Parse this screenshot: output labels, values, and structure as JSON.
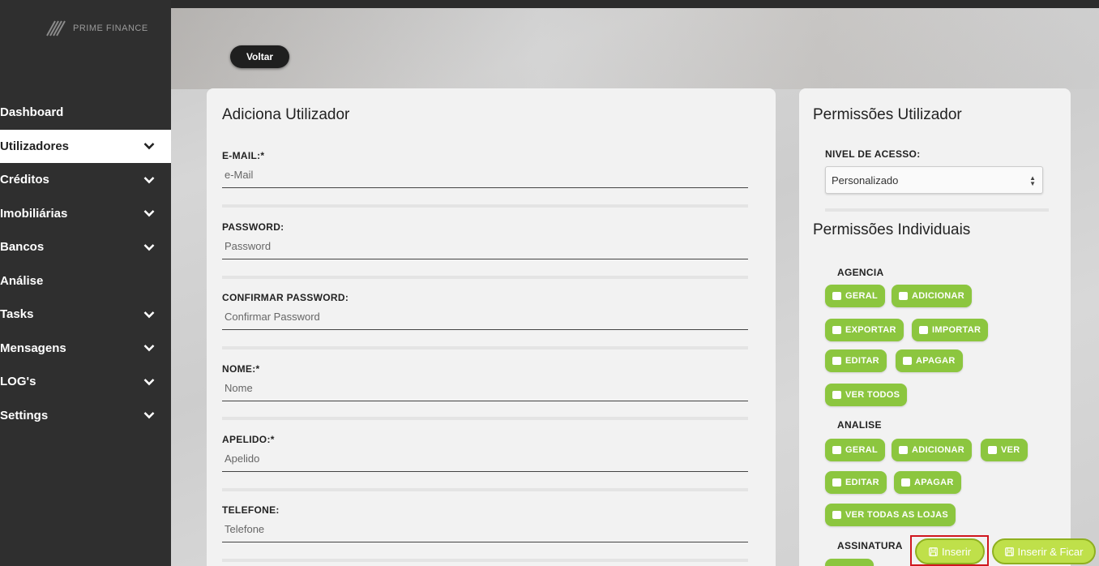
{
  "brand": {
    "name": "PRIME FINANCE"
  },
  "sidebar": {
    "items": [
      {
        "label": "Dashboard",
        "chevron": false,
        "active": false
      },
      {
        "label": "Utilizadores",
        "chevron": true,
        "active": true
      },
      {
        "label": "Créditos",
        "chevron": true,
        "active": false
      },
      {
        "label": "Imobiliárias",
        "chevron": true,
        "active": false
      },
      {
        "label": "Bancos",
        "chevron": true,
        "active": false
      },
      {
        "label": "Análise",
        "chevron": false,
        "active": false
      },
      {
        "label": "Tasks",
        "chevron": true,
        "active": false
      },
      {
        "label": "Mensagens",
        "chevron": true,
        "active": false
      },
      {
        "label": "LOG's",
        "chevron": true,
        "active": false
      },
      {
        "label": "Settings",
        "chevron": true,
        "active": false
      }
    ]
  },
  "back_button": {
    "label": "Voltar"
  },
  "user_form": {
    "title": "Adiciona Utilizador",
    "fields": [
      {
        "label": "E-MAIL:*",
        "placeholder": "e-Mail"
      },
      {
        "label": "PASSWORD:",
        "placeholder": "Password"
      },
      {
        "label": "CONFIRMAR PASSWORD:",
        "placeholder": "Confirmar Password"
      },
      {
        "label": "NOME:*",
        "placeholder": "Nome"
      },
      {
        "label": "APELIDO:*",
        "placeholder": "Apelido"
      },
      {
        "label": "TELEFONE:",
        "placeholder": "Telefone"
      }
    ]
  },
  "permissions": {
    "title": "Permissões Utilizador",
    "access_level_label": "NIVEL DE ACESSO:",
    "access_level_value": "Personalizado",
    "individual_title": "Permissões Individuais",
    "groups": [
      {
        "name": "AGENCIA",
        "items": [
          "GERAL",
          "ADICIONAR",
          "EXPORTAR",
          "IMPORTAR",
          "EDITAR",
          "APAGAR",
          "VER TODOS"
        ]
      },
      {
        "name": "ANALISE",
        "items": [
          "GERAL",
          "ADICIONAR",
          "VER",
          "EDITAR",
          "APAGAR",
          "VER TODAS AS LOJAS"
        ]
      },
      {
        "name": "ASSINATURA",
        "items": []
      }
    ]
  },
  "actions": {
    "insert_label": "Inserir",
    "insert_stay_label": "Inserir & Ficar"
  },
  "colors": {
    "accent_green": "#8cc63f",
    "action_green": "#bfe04a",
    "sidebar_bg": "#2f2f2f",
    "highlight_red": "#d0161e"
  }
}
